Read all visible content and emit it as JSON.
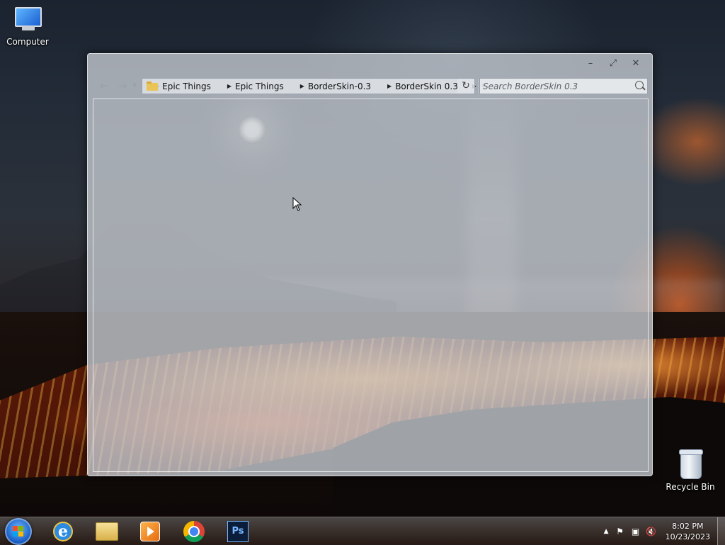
{
  "desktop": {
    "icons": [
      {
        "label": "Computer"
      },
      {
        "label": "Recycle Bin"
      }
    ]
  },
  "window": {
    "caption_buttons": {
      "minimize": "–",
      "maximize": "⤢",
      "close": "✕"
    },
    "breadcrumb": [
      "Epic Things",
      "Epic Things",
      "BorderSkin-0.3",
      "BorderSkin 0.3"
    ],
    "search": {
      "placeholder": "Search BorderSkin 0.3"
    }
  },
  "taskbar": {
    "apps": [
      {
        "name": "internet-explorer"
      },
      {
        "name": "windows-explorer"
      },
      {
        "name": "media-player"
      },
      {
        "name": "chrome"
      },
      {
        "name": "photoshop",
        "glyph": "Ps"
      }
    ],
    "clock": {
      "time": "8:02 PM",
      "date": "10/23/2023"
    }
  }
}
